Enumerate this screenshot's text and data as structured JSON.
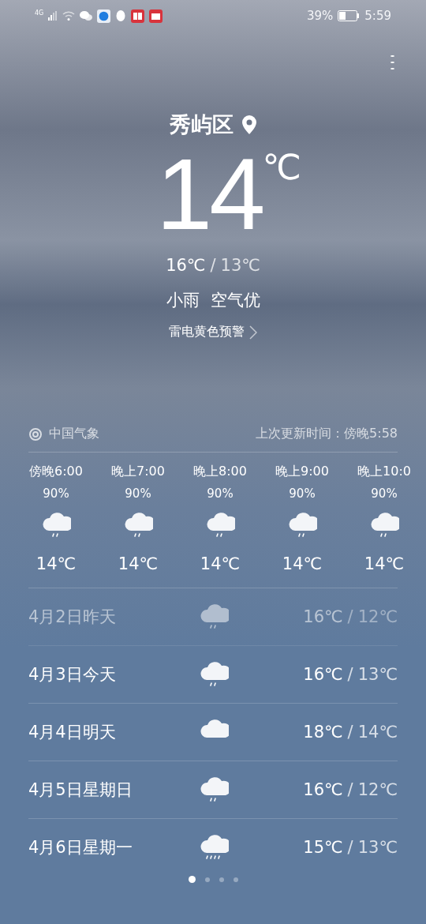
{
  "status_bar": {
    "network": "4G",
    "battery_percent": "39%",
    "time": "5:59",
    "notification_apps": [
      {
        "kind": "browser"
      },
      {
        "kind": "qq"
      },
      {
        "kind": "book"
      },
      {
        "kind": "calendar"
      }
    ]
  },
  "location": {
    "name": "秀屿区"
  },
  "current": {
    "temp": "14",
    "unit": "℃",
    "high": "16℃",
    "separator": "/",
    "low": "13℃",
    "condition": "小雨",
    "air_quality": "空气优",
    "alert": "雷电黄色预警"
  },
  "source": {
    "name": "中国气象",
    "updated": "上次更新时间：傍晚5:58"
  },
  "hourly": [
    {
      "time": "傍晚6:00",
      "chance": "90%",
      "kind": "rain",
      "temp": "14℃"
    },
    {
      "time": "晚上7:00",
      "chance": "90%",
      "kind": "rain",
      "temp": "14℃"
    },
    {
      "time": "晚上8:00",
      "chance": "90%",
      "kind": "rain",
      "temp": "14℃"
    },
    {
      "time": "晚上9:00",
      "chance": "90%",
      "kind": "rain",
      "temp": "14℃"
    },
    {
      "time": "晚上10:0",
      "chance": "90%",
      "kind": "rain",
      "temp": "14℃"
    }
  ],
  "daily": [
    {
      "date": "4月2日昨天",
      "kind": "rain",
      "high": "16℃",
      "low": "12℃",
      "past": true
    },
    {
      "date": "4月3日今天",
      "kind": "rain",
      "high": "16℃",
      "low": "13℃",
      "past": false
    },
    {
      "date": "4月4日明天",
      "kind": "cloudy",
      "high": "18℃",
      "low": "14℃",
      "past": false
    },
    {
      "date": "4月5日星期日",
      "kind": "rain",
      "high": "16℃",
      "low": "12℃",
      "past": false
    },
    {
      "date": "4月6日星期一",
      "kind": "heavy",
      "high": "15℃",
      "low": "13℃",
      "past": false
    }
  ],
  "range_separator": "/",
  "page_dots": [
    {
      "selected": true
    },
    {
      "selected": false
    },
    {
      "selected": false
    },
    {
      "selected": false
    }
  ]
}
